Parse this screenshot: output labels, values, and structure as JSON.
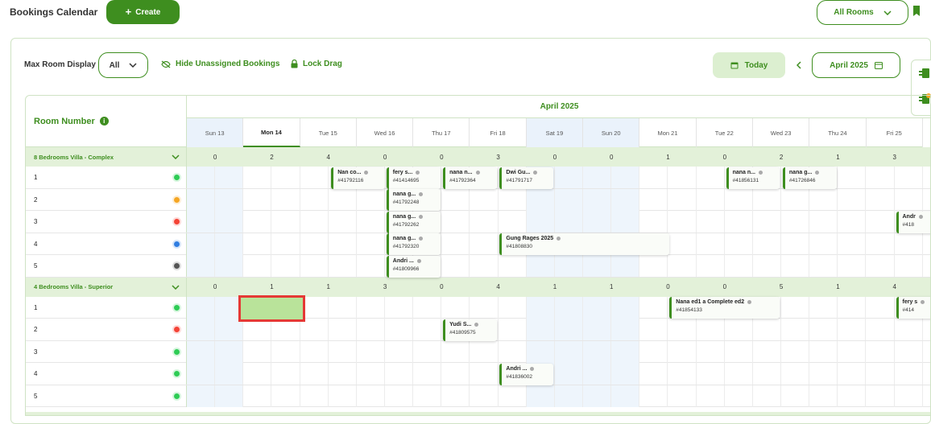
{
  "header": {
    "title": "Bookings Calendar",
    "create_label": "Create",
    "rooms_filter": "All Rooms"
  },
  "controls": {
    "max_room_label": "Max Room Display",
    "max_room_value": "All",
    "hide_unassigned_label": "Hide Unassigned Bookings",
    "lock_drag_label": "Lock Drag",
    "today_label": "Today",
    "month_label": "April 2025"
  },
  "calendar": {
    "room_column_label": "Room Number",
    "month_title": "April 2025",
    "days": [
      {
        "label": "Sun 13",
        "weekend": true
      },
      {
        "label": "Mon 14",
        "today": true
      },
      {
        "label": "Tue 15"
      },
      {
        "label": "Wed 16"
      },
      {
        "label": "Thu 17"
      },
      {
        "label": "Fri 18"
      },
      {
        "label": "Sat 19",
        "weekend": true
      },
      {
        "label": "Sun 20",
        "weekend": true
      },
      {
        "label": "Mon 21"
      },
      {
        "label": "Tue 22"
      },
      {
        "label": "Wed 23"
      },
      {
        "label": "Thu 24"
      },
      {
        "label": "Fri 25"
      }
    ],
    "groups": [
      {
        "name": "8 Bedrooms Villa - Complex",
        "counts": [
          "0",
          "2",
          "4",
          "0",
          "0",
          "3",
          "0",
          "0",
          "1",
          "0",
          "2",
          "1",
          "3"
        ],
        "rooms": [
          {
            "number": "1",
            "status_color": "#2ecc55"
          },
          {
            "number": "2",
            "status_color": "#f5a623"
          },
          {
            "number": "3",
            "status_color": "#f44336"
          },
          {
            "number": "4",
            "status_color": "#2f7de1"
          },
          {
            "number": "5",
            "status_color": "#555555"
          }
        ]
      },
      {
        "name": "4 Bedrooms Villa - Superior",
        "counts": [
          "0",
          "1",
          "1",
          "3",
          "0",
          "4",
          "1",
          "1",
          "0",
          "0",
          "5",
          "1",
          "4"
        ],
        "rooms": [
          {
            "number": "1",
            "status_color": "#2ecc55"
          },
          {
            "number": "2",
            "status_color": "#f44336"
          },
          {
            "number": "3",
            "status_color": "#2ecc55"
          },
          {
            "number": "4",
            "status_color": "#2ecc55"
          },
          {
            "number": "5",
            "status_color": "#2ecc55"
          }
        ]
      }
    ],
    "bookings": [
      {
        "name": "Nan co...",
        "id": "#41792116"
      },
      {
        "name": "fery s...",
        "id": "#41414695"
      },
      {
        "name": "nana n...",
        "id": "#41792364"
      },
      {
        "name": "Dwi Gu...",
        "id": "#41791717"
      },
      {
        "name": "nana n...",
        "id": "#41856131"
      },
      {
        "name": "nana g...",
        "id": "#41726846"
      },
      {
        "name": "nana g...",
        "id": "#41792248"
      },
      {
        "name": "nana g...",
        "id": "#41792262"
      },
      {
        "name": "Andr",
        "id": "#418"
      },
      {
        "name": "nana g...",
        "id": "#41792320"
      },
      {
        "name": "Gung Rages 2025",
        "id": "#41808830"
      },
      {
        "name": "Andri ...",
        "id": "#41809966"
      },
      {
        "name": "Nana ed1 a Complete ed2",
        "id": "#41854133"
      },
      {
        "name": "fery s",
        "id": "#414"
      },
      {
        "name": "Yudi S...",
        "id": "#41809575"
      },
      {
        "name": "Andri ...",
        "id": "#41836002"
      }
    ]
  }
}
